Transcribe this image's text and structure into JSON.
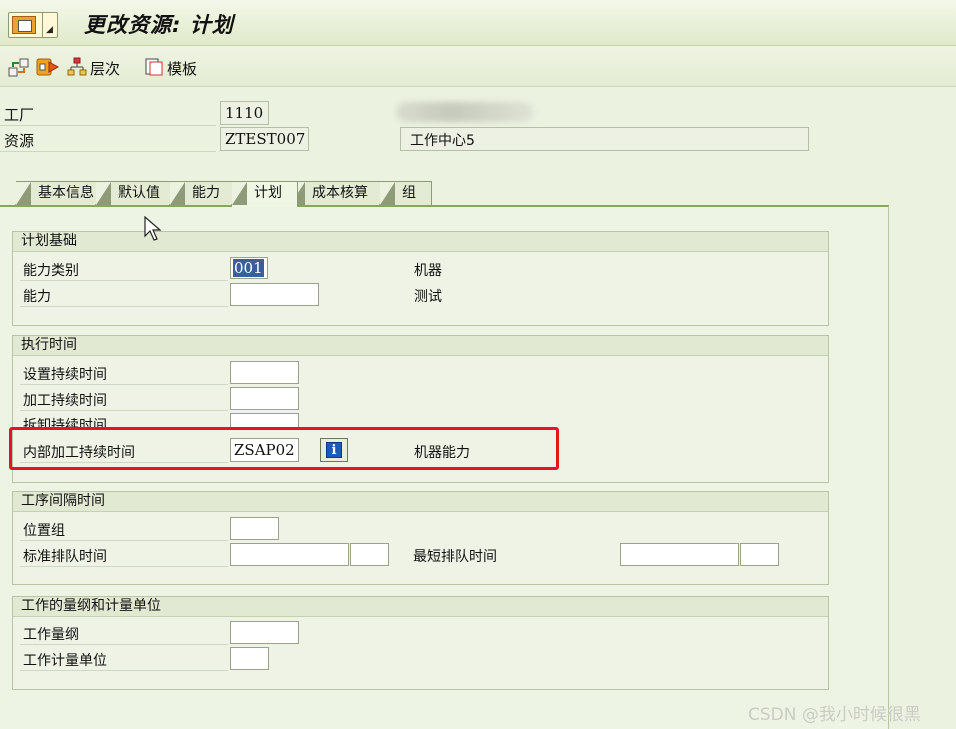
{
  "window": {
    "title": "更改资源: 计划"
  },
  "toolbar": {
    "hierarchy_label": "层次",
    "template_label": "模板"
  },
  "header": {
    "plant_label": "工厂",
    "plant_value": "1110",
    "resource_label": "资源",
    "resource_value": "ZTEST007",
    "resource_desc": "工作中心5"
  },
  "tabs": [
    {
      "label": "基本信息"
    },
    {
      "label": "默认值"
    },
    {
      "label": "能力"
    },
    {
      "label": "计划"
    },
    {
      "label": "成本核算"
    },
    {
      "label": "组"
    }
  ],
  "planning_basis": {
    "title": "计划基础",
    "capacity_category_label": "能力类别",
    "capacity_category_value": "001",
    "capacity_category_desc": "机器",
    "capacity_label": "能力",
    "capacity_value": "",
    "capacity_desc": "测试"
  },
  "execution_time": {
    "title": "执行时间",
    "setup_label": "设置持续时间",
    "processing_label": "加工持续时间",
    "teardown_label": "拆卸持续时间",
    "internal_label": "内部加工持续时间",
    "internal_value": "ZSAP02",
    "internal_desc": "机器能力"
  },
  "interop_time": {
    "title": "工序间隔时间",
    "location_group_label": "位置组",
    "std_queue_label": "标准排队时间",
    "min_queue_label": "最短排队时间"
  },
  "work_dimension": {
    "title": "工作的量纲和计量单位",
    "dimension_label": "工作量纲",
    "unit_label": "工作计量单位"
  },
  "watermark": "CSDN @我小时候很黑",
  "colors": {
    "highlight": "#e8141b",
    "active_tab_border": "#86a85a",
    "info_icon": "#1d59b8"
  }
}
